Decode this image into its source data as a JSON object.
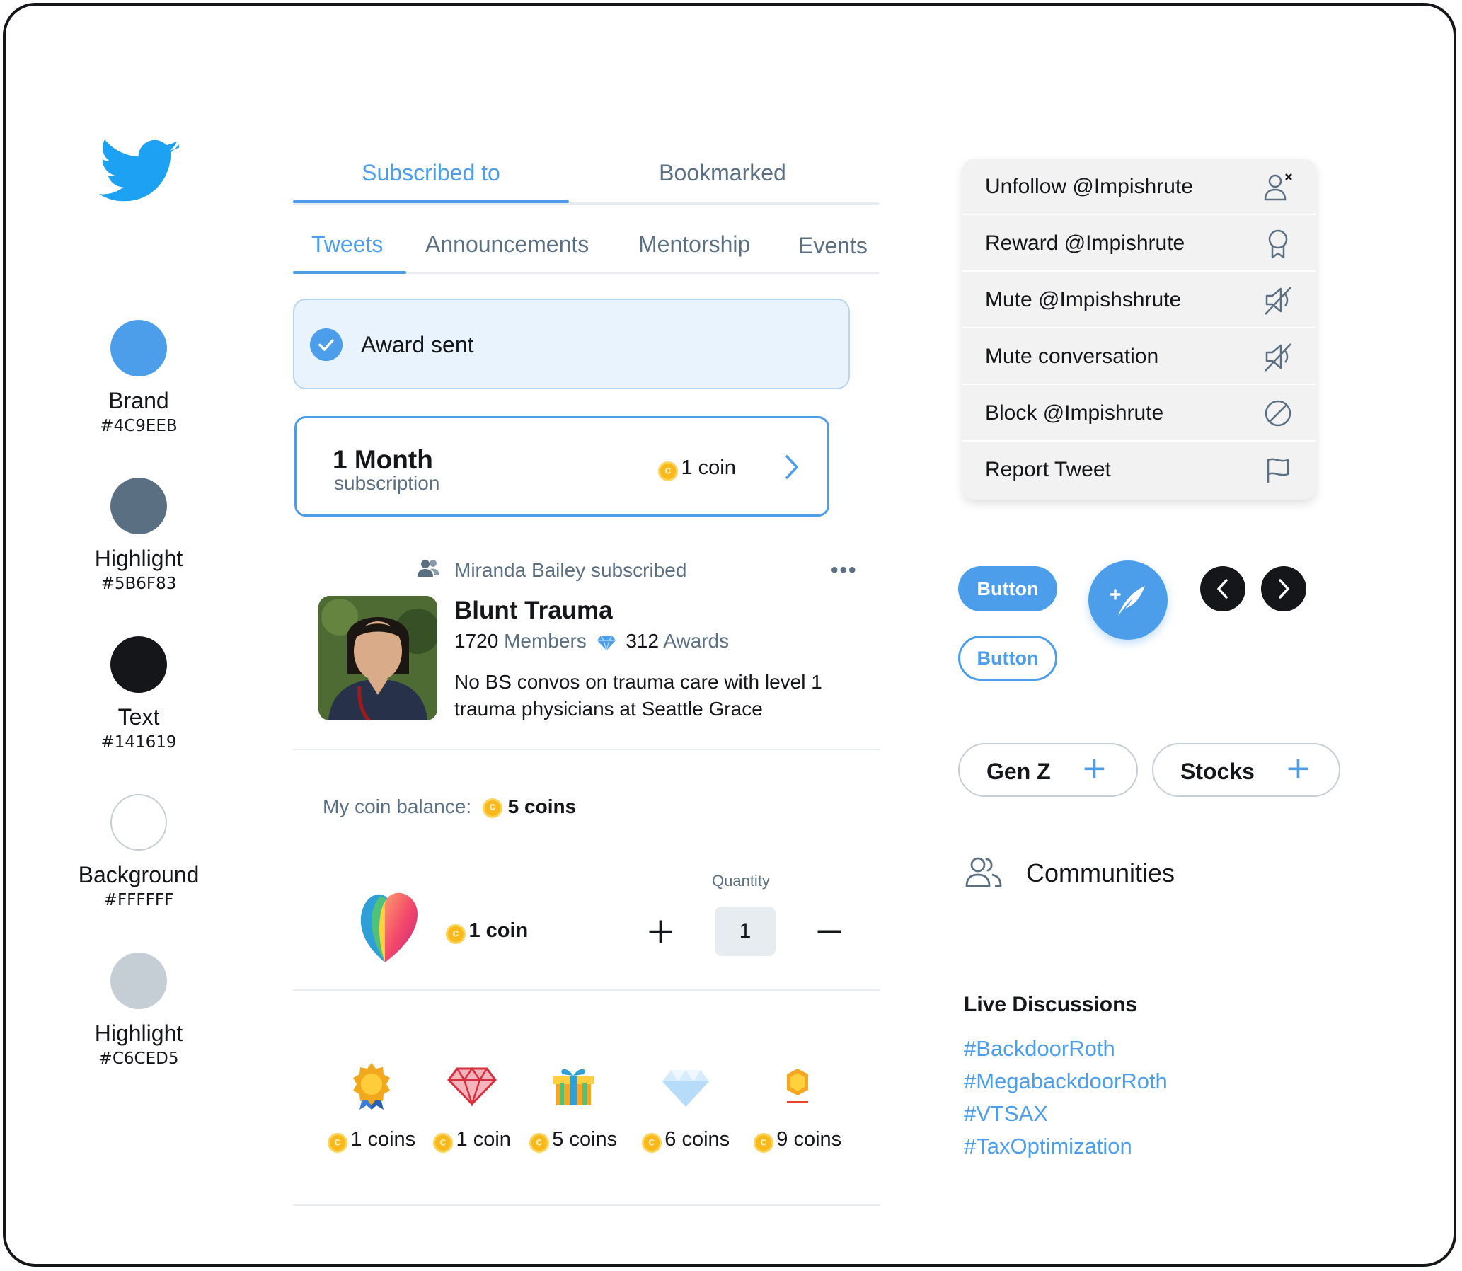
{
  "colors": {
    "brand": "#4C9EEB",
    "highlight_dark": "#5B6F83",
    "text": "#141619",
    "background": "#FFFFFF",
    "highlight_light": "#C6CED5"
  },
  "logo": {
    "icon": "twitter-bird-icon"
  },
  "palette": [
    {
      "name": "Brand",
      "hex": "#4C9EEB"
    },
    {
      "name": "Highlight",
      "hex": "#5B6F83"
    },
    {
      "name": "Text",
      "hex": "#141619"
    },
    {
      "name": "Background",
      "hex": "#FFFFFF"
    },
    {
      "name": "Highlight",
      "hex": "#C6CED5"
    }
  ],
  "top_tabs": [
    {
      "label": "Subscribed to",
      "active": true
    },
    {
      "label": "Bookmarked",
      "active": false
    }
  ],
  "sub_tabs": [
    {
      "label": "Tweets",
      "active": true
    },
    {
      "label": "Announcements",
      "active": false
    },
    {
      "label": "Mentorship",
      "active": false
    },
    {
      "label": "Events",
      "active": false
    }
  ],
  "toast": {
    "text": "Award sent",
    "icon": "check-circle-icon"
  },
  "subscription": {
    "title": "1 Month",
    "subtitle": "subscription",
    "price": "1 coin",
    "icon": "chevron-right-icon"
  },
  "post": {
    "meta": "Miranda Bailey subscribed",
    "community_name": "Blunt Trauma",
    "members_count": "1720",
    "members_label": "Members",
    "awards_count": "312",
    "awards_label": "Awards",
    "description_line1": "No BS convos on trauma care with level 1",
    "description_line2": "trauma physicians at Seattle Grace"
  },
  "balance": {
    "label": "My coin balance:",
    "value": "5 coins"
  },
  "purchase": {
    "price": "1 coin",
    "quantity_label": "Quantity",
    "quantity": "1"
  },
  "awards": [
    {
      "icon": "medal-icon",
      "price": "1 coins"
    },
    {
      "icon": "ruby-gem-icon",
      "price": "1 coin"
    },
    {
      "icon": "gift-box-icon",
      "price": "5 coins"
    },
    {
      "icon": "diamond-icon",
      "price": "6 coins"
    },
    {
      "icon": "gold-hexagon-icon",
      "price": "9 coins"
    }
  ],
  "menu": [
    {
      "label": "Unfollow @Impishrute",
      "icon": "unfollow-user-icon"
    },
    {
      "label": "Reward @Impishrute",
      "icon": "award-ribbon-icon"
    },
    {
      "label": "Mute @Impishshrute",
      "icon": "speaker-muted-icon"
    },
    {
      "label": "Mute conversation",
      "icon": "speaker-muted-icon"
    },
    {
      "label": "Block @Impishrute",
      "icon": "block-icon"
    },
    {
      "label": "Report Tweet",
      "icon": "flag-icon"
    }
  ],
  "buttons": {
    "primary_label": "Button",
    "secondary_label": "Button"
  },
  "chips": [
    {
      "label": "Gen Z"
    },
    {
      "label": "Stocks"
    }
  ],
  "communities": {
    "label": "Communities",
    "icon": "people-icon"
  },
  "live": {
    "title": "Live Discussions",
    "hashtags": [
      "#BackdoorRoth",
      "#MegabackdoorRoth",
      "#VTSAX",
      "#TaxOptimization"
    ]
  }
}
